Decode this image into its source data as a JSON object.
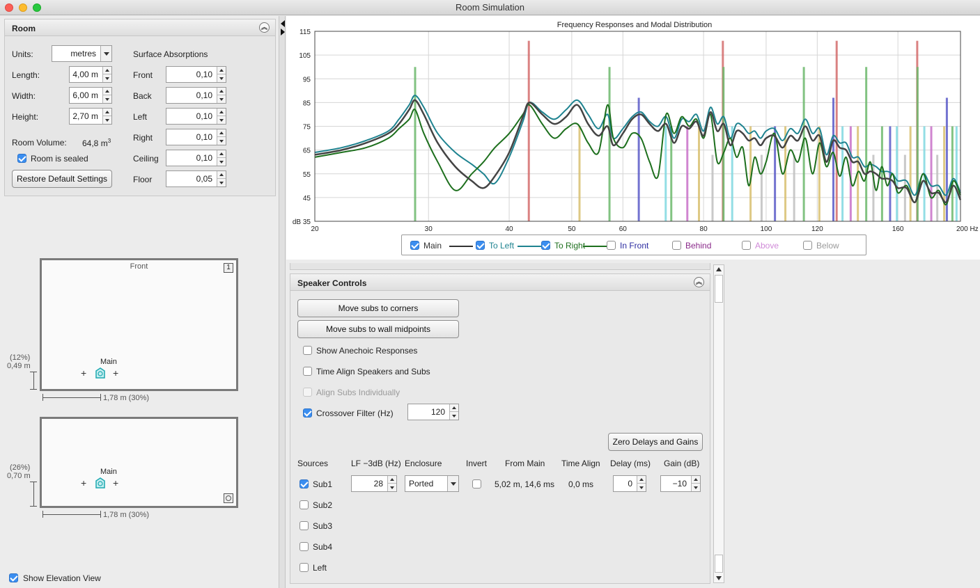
{
  "window": {
    "title": "Room Simulation"
  },
  "room_panel": {
    "title": "Room",
    "units_label": "Units:",
    "units_value": "metres",
    "length_label": "Length:",
    "length_value": "4,00 m",
    "width_label": "Width:",
    "width_value": "6,00 m",
    "height_label": "Height:",
    "height_value": "2,70 m",
    "volume_label": "Room Volume:",
    "volume_value": "64,8 m",
    "volume_unit_sup": "3",
    "sealed_label": "Room is sealed",
    "restore_label": "Restore Default Settings",
    "surface_title": "Surface Absorptions",
    "surfaces": [
      {
        "label": "Front",
        "value": "0,10"
      },
      {
        "label": "Back",
        "value": "0,10"
      },
      {
        "label": "Left",
        "value": "0,10"
      },
      {
        "label": "Right",
        "value": "0,10"
      },
      {
        "label": "Ceiling",
        "value": "0,10"
      },
      {
        "label": "Floor",
        "value": "0,05"
      }
    ]
  },
  "plan_view": {
    "front_label": "Front",
    "icon_label": "1",
    "speaker_label": "Main",
    "y_pct": "(12%)",
    "y_dist": "0,49 m",
    "x_dim": "1,78 m  (30%)"
  },
  "elevation_view": {
    "speaker_label": "Main",
    "y_pct": "(26%)",
    "y_dist": "0,70 m",
    "x_dim": "1,78 m  (30%)",
    "show_label": "Show Elevation View"
  },
  "chart_data": {
    "type": "line",
    "title": "Frequency Responses and Modal Distribution",
    "xscale": "log",
    "xlim": [
      20,
      200
    ],
    "ylim": [
      35,
      115
    ],
    "xticks": [
      20,
      30,
      40,
      50,
      60,
      80,
      100,
      120,
      160,
      200
    ],
    "xtick_labels": [
      "20",
      "30",
      "40",
      "50",
      "60",
      "80",
      "100",
      "120",
      "160",
      "200 Hz"
    ],
    "yticks": [
      35,
      45,
      55,
      65,
      75,
      85,
      95,
      105,
      115
    ],
    "ytick_labels": [
      "dB 35",
      "45",
      "55",
      "65",
      "75",
      "85",
      "95",
      "105",
      "115"
    ],
    "grid": true,
    "colors": {
      "Main": "#444444",
      "To Left": "#1e8390",
      "To Right": "#1d6f1d"
    },
    "series": [
      {
        "name": "Main",
        "x": [
          20,
          22,
          24,
          26,
          27,
          28,
          28.6,
          29.5,
          31,
          33,
          35,
          36.5,
          38,
          40,
          42,
          43,
          45,
          47,
          49,
          51,
          53,
          55,
          56.8,
          58,
          60,
          62,
          64,
          66,
          68,
          70,
          72,
          74,
          76,
          78,
          80,
          82,
          84,
          86,
          88,
          90,
          92,
          94,
          96,
          98,
          100,
          103,
          106,
          109,
          112,
          115,
          118,
          121,
          124,
          127,
          130,
          133,
          136,
          139,
          142,
          145,
          148,
          151,
          154,
          157,
          160,
          165,
          170,
          175,
          180,
          185,
          190,
          195,
          200
        ],
        "values": [
          63,
          65,
          68,
          72,
          76,
          82,
          86,
          80,
          68,
          58,
          52,
          49,
          54,
          64,
          79,
          85,
          80,
          76,
          79,
          84,
          76,
          71,
          75,
          67,
          72,
          78,
          80,
          76,
          73,
          76,
          68,
          75,
          74,
          77,
          71,
          81,
          73,
          76,
          67,
          73,
          72,
          69,
          70,
          67,
          70,
          71,
          66,
          71,
          69,
          75,
          69,
          71,
          60,
          69,
          66,
          65,
          60,
          60,
          55,
          56,
          55,
          53,
          53,
          52,
          49,
          49,
          43,
          52,
          47,
          47,
          43,
          50,
          44
        ]
      },
      {
        "name": "To Left",
        "x": [
          20,
          22,
          24,
          26,
          27,
          28,
          28.6,
          29.5,
          31,
          33,
          35,
          36.5,
          38,
          40,
          42,
          43,
          45,
          47,
          49,
          51,
          53,
          55,
          56.8,
          58,
          60,
          62,
          64,
          66,
          68,
          70,
          72,
          74,
          76,
          78,
          80,
          82,
          84,
          86,
          88,
          90,
          92,
          94,
          96,
          98,
          100,
          103,
          106,
          109,
          112,
          115,
          118,
          121,
          124,
          127,
          130,
          133,
          136,
          139,
          142,
          145,
          148,
          151,
          154,
          157,
          160,
          165,
          170,
          175,
          180,
          185,
          190,
          195,
          200
        ],
        "values": [
          64,
          66,
          69,
          73,
          78,
          84,
          88,
          83,
          72,
          64,
          59,
          55,
          51,
          62,
          77,
          85,
          81,
          78,
          82,
          86,
          80,
          74,
          80,
          70,
          74,
          79,
          81,
          77,
          75,
          79,
          70,
          78,
          77,
          80,
          73,
          83,
          76,
          79,
          70,
          76,
          75,
          72,
          73,
          70,
          73,
          74,
          69,
          74,
          72,
          78,
          72,
          74,
          63,
          71,
          68,
          68,
          62,
          62,
          58,
          59,
          58,
          56,
          56,
          55,
          52,
          52,
          46,
          55,
          50,
          50,
          46,
          53,
          47
        ]
      },
      {
        "name": "To Right",
        "x": [
          20,
          22,
          24,
          26,
          27,
          28,
          28.6,
          29.5,
          31,
          33,
          35,
          36.5,
          38,
          40,
          42,
          43,
          45,
          47,
          49,
          51,
          53,
          55,
          56.8,
          58,
          60,
          62,
          64,
          66,
          68,
          70,
          72,
          74,
          76,
          78,
          80,
          82,
          84,
          86,
          88,
          90,
          92,
          94,
          96,
          98,
          100,
          103,
          106,
          109,
          112,
          115,
          118,
          121,
          124,
          127,
          130,
          133,
          136,
          139,
          142,
          145,
          148,
          151,
          154,
          157,
          160,
          165,
          170,
          175,
          180,
          185,
          190,
          195,
          200
        ],
        "values": [
          62,
          64,
          66,
          70,
          74,
          78,
          82,
          72,
          60,
          48,
          55,
          60,
          66,
          72,
          80,
          84,
          76,
          70,
          74,
          76,
          68,
          64,
          84,
          70,
          66,
          72,
          70,
          60,
          54,
          80,
          72,
          79,
          75,
          78,
          70,
          80,
          60,
          64,
          70,
          62,
          66,
          50,
          62,
          55,
          60,
          72,
          55,
          65,
          60,
          70,
          55,
          68,
          58,
          64,
          54,
          62,
          50,
          56,
          52,
          60,
          48,
          58,
          50,
          55,
          47,
          50,
          43,
          55,
          45,
          48,
          42,
          52,
          46
        ]
      }
    ],
    "modes": [
      {
        "f": 28.6,
        "value": 100,
        "color": "#6cb86c"
      },
      {
        "f": 42.9,
        "value": 111,
        "color": "#d46c6c"
      },
      {
        "f": 51.4,
        "value": 75,
        "color": "#d8c070"
      },
      {
        "f": 57.2,
        "value": 100,
        "color": "#6cb86c"
      },
      {
        "f": 63.5,
        "value": 87,
        "color": "#5a5ac8"
      },
      {
        "f": 69.9,
        "value": 75,
        "color": "#80d8e0"
      },
      {
        "f": 71.3,
        "value": 75,
        "color": "#6cb86c"
      },
      {
        "f": 75.5,
        "value": 75,
        "color": "#c870c8"
      },
      {
        "f": 78.7,
        "value": 75,
        "color": "#d8c070"
      },
      {
        "f": 82.6,
        "value": 63,
        "color": "#c0c0c0"
      },
      {
        "f": 85.7,
        "value": 111,
        "color": "#d46c6c"
      },
      {
        "f": 85.9,
        "value": 100,
        "color": "#6cb86c"
      },
      {
        "f": 88.6,
        "value": 75,
        "color": "#80d8e0"
      },
      {
        "f": 94.6,
        "value": 75,
        "color": "#d8c070"
      },
      {
        "f": 98.4,
        "value": 63,
        "color": "#c0c0c0"
      },
      {
        "f": 103.2,
        "value": 75,
        "color": "#5a5ac8"
      },
      {
        "f": 107.1,
        "value": 75,
        "color": "#d8c070"
      },
      {
        "f": 110.5,
        "value": 63,
        "color": "#c0c0c0"
      },
      {
        "f": 114.4,
        "value": 100,
        "color": "#6cb86c"
      },
      {
        "f": 120.9,
        "value": 75,
        "color": "#d8c070"
      },
      {
        "f": 127.1,
        "value": 87,
        "color": "#5a5ac8"
      },
      {
        "f": 128.6,
        "value": 111,
        "color": "#d46c6c"
      },
      {
        "f": 131.3,
        "value": 75,
        "color": "#80d8e0"
      },
      {
        "f": 135.2,
        "value": 75,
        "color": "#c870c8"
      },
      {
        "f": 138.7,
        "value": 75,
        "color": "#d8c070"
      },
      {
        "f": 142.9,
        "value": 100,
        "color": "#6cb86c"
      },
      {
        "f": 146.6,
        "value": 63,
        "color": "#c0c0c0"
      },
      {
        "f": 151.2,
        "value": 75,
        "color": "#6cb86c"
      },
      {
        "f": 155.6,
        "value": 75,
        "color": "#5a5ac8"
      },
      {
        "f": 159.4,
        "value": 75,
        "color": "#80d8e0"
      },
      {
        "f": 164.1,
        "value": 63,
        "color": "#c0c0c0"
      },
      {
        "f": 167.3,
        "value": 75,
        "color": "#d8c070"
      },
      {
        "f": 171.4,
        "value": 111,
        "color": "#d46c6c"
      },
      {
        "f": 171.6,
        "value": 100,
        "color": "#6cb86c"
      },
      {
        "f": 175.8,
        "value": 75,
        "color": "#80d8e0"
      },
      {
        "f": 180.2,
        "value": 75,
        "color": "#c870c8"
      },
      {
        "f": 184.1,
        "value": 63,
        "color": "#c0c0c0"
      },
      {
        "f": 188.7,
        "value": 75,
        "color": "#d8c070"
      },
      {
        "f": 190.5,
        "value": 87,
        "color": "#5a5ac8"
      },
      {
        "f": 194.3,
        "value": 75,
        "color": "#6cb86c"
      },
      {
        "f": 197.2,
        "value": 75,
        "color": "#80d8e0"
      }
    ]
  },
  "legend": [
    {
      "label": "Main",
      "checked": true,
      "color": "#333333"
    },
    {
      "label": "To Left",
      "checked": true,
      "color": "#1e8390"
    },
    {
      "label": "To Right",
      "checked": true,
      "color": "#1d6f1d"
    },
    {
      "label": "In Front",
      "checked": false,
      "color": "#2a2aa0"
    },
    {
      "label": "Behind",
      "checked": false,
      "color": "#8a2a8a"
    },
    {
      "label": "Above",
      "checked": false,
      "color": "#d08ad8"
    },
    {
      "label": "Below",
      "checked": false,
      "color": "#9a9a9a"
    }
  ],
  "speaker_panel": {
    "title": "Speaker Controls",
    "move_corners": "Move subs to corners",
    "move_midpoints": "Move subs to wall midpoints",
    "anechoic": "Show Anechoic Responses",
    "time_align": "Time Align Speakers and Subs",
    "align_individually": "Align Subs Individually",
    "crossover": "Crossover Filter (Hz)",
    "crossover_value": "120",
    "zero_delays": "Zero Delays and Gains",
    "headers": {
      "sources": "Sources",
      "lf": "LF −3dB (Hz)",
      "enclosure": "Enclosure",
      "invert": "Invert",
      "from_main": "From Main",
      "time_align": "Time Align",
      "delay": "Delay (ms)",
      "gain": "Gain (dB)"
    },
    "sub1": {
      "label": "Sub1",
      "lf": "28",
      "enclosure": "Ported",
      "from_main": "5,02 m, 14,6 ms",
      "time_align": "0,0 ms",
      "delay": "0",
      "gain": "−10"
    },
    "other_sources": [
      "Sub2",
      "Sub3",
      "Sub4",
      "Left"
    ]
  }
}
